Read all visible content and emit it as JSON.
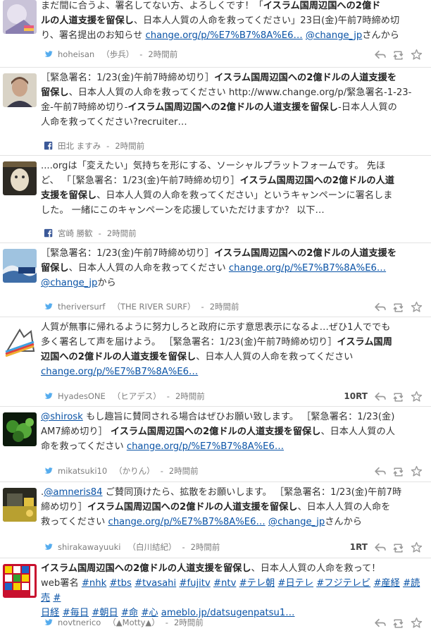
{
  "posts": [
    {
      "lines": [
        [
          {
            "t": "まだ間に合うよ、署名してない方、よろしくです！「"
          },
          {
            "t": "イスラム国周辺国への2億ド",
            "b": 1
          }
        ],
        [
          {
            "t": "ルの人道支援を留保し",
            "b": 1
          },
          {
            "t": "、日本人人質の人命を救ってください」23日(金)午前7時締め切"
          }
        ],
        [
          {
            "t": "り、署名提出のお知らせ "
          },
          {
            "t": "change.org/p/%E7%B7%8A%E6…",
            "a": 1
          },
          {
            "t": " "
          },
          {
            "t": "@change_jp",
            "a": 1
          },
          {
            "t": "さんから"
          }
        ]
      ],
      "user": "hoheisan",
      "realname": "（歩兵）",
      "time": "2時間前",
      "source": "twitter",
      "rt": ""
    },
    {
      "lines": [
        [
          {
            "t": "［緊急署名：1/23(金)午前7時締め切り］"
          },
          {
            "t": "イスラム国周辺国への2億ドルの人道支援を",
            "b": 1
          }
        ],
        [
          {
            "t": "留保し",
            "b": 1
          },
          {
            "t": "、日本人人質の人命を救ってください http://www.change.org/p/緊急署名-1-23-"
          }
        ],
        [
          {
            "t": "金-午前7時締め切り-"
          },
          {
            "t": "イスラム国周辺国への2億ドルの人道支援を留保し",
            "b": 1
          },
          {
            "t": "-日本人人質の"
          }
        ],
        [
          {
            "t": "人命を救ってください?recruiter…"
          }
        ]
      ],
      "user": "田北 ますみ",
      "realname": "",
      "time": "2時間前",
      "source": "facebook",
      "rt": ""
    },
    {
      "lines": [
        [
          {
            "t": "....orgは「変えたい」気持ちを形にする、ソーシャルプラットフォームです。 先ほ"
          }
        ],
        [
          {
            "t": "ど、 「［緊急署名：1/23(金)午前7時締め切り］"
          },
          {
            "t": "イスラム国周辺国への2億ドルの人道",
            "b": 1
          }
        ],
        [
          {
            "t": "支援を留保し",
            "b": 1
          },
          {
            "t": "、日本人人質の人命を救ってください」というキャンペーンに署名しま"
          }
        ],
        [
          {
            "t": "した。 一緒にこのキャンペーンを応援していただけますか？ 以下…"
          }
        ]
      ],
      "user": "宮崎 勝歓",
      "realname": "",
      "time": "2時間前",
      "source": "facebook",
      "rt": ""
    },
    {
      "lines": [
        [
          {
            "t": "［緊急署名：1/23(金)午前7時締め切り］"
          },
          {
            "t": "イスラム国周辺国への2億ドルの人道支援を",
            "b": 1
          }
        ],
        [
          {
            "t": "留保し",
            "b": 1
          },
          {
            "t": "、日本人人質の人命を救ってください "
          },
          {
            "t": "change.org/p/%E7%B7%8A%E6…",
            "a": 1
          }
        ],
        [
          {
            "t": "@change_jp",
            "a": 1
          },
          {
            "t": "から"
          }
        ]
      ],
      "user": "theriversurf",
      "realname": "（THE RIVER SURF）",
      "time": "2時間前",
      "source": "twitter",
      "rt": ""
    },
    {
      "lines": [
        [
          {
            "t": "人質が無事に帰れるように努力しろと政府に示す意思表示になるよ…ぜひ1人ででも"
          }
        ],
        [
          {
            "t": "多く署名して声を届けよう。 ［緊急署名：1/23(金)午前7時締め切り］"
          },
          {
            "t": "イスラム国周",
            "b": 1
          }
        ],
        [
          {
            "t": "辺国への2億ドルの人道支援を留保し",
            "b": 1
          },
          {
            "t": "、日本人人質の人命を救ってください"
          }
        ],
        [
          {
            "t": "change.org/p/%E7%B7%8A%E6…",
            "a": 1
          }
        ]
      ],
      "user": "HyadesONE",
      "realname": "（ヒアデス）",
      "time": "2時間前",
      "source": "twitter",
      "rt": "10RT"
    },
    {
      "lines": [
        [
          {
            "t": "@shirosk",
            "a": 1
          },
          {
            "t": " もし趣旨に賛同される場合はぜひお願い致します。 ［緊急署名：1/23(金)"
          }
        ],
        [
          {
            "t": "AM7締め切り］ "
          },
          {
            "t": "イスラム国周辺国への2億ドルの人道支援を留保し",
            "b": 1
          },
          {
            "t": "、日本人人質の人"
          }
        ],
        [
          {
            "t": "命を救ってください "
          },
          {
            "t": "change.org/p/%E7%B7%8A%E6…",
            "a": 1
          }
        ]
      ],
      "user": "mikatsuki10",
      "realname": "（かりん）",
      "time": "2時間前",
      "source": "twitter",
      "rt": ""
    },
    {
      "lines": [
        [
          {
            "t": "."
          },
          {
            "t": "@amneris84",
            "a": 1
          },
          {
            "t": " ご賛同頂けたら、拡散をお願いします。 ［緊急署名：1/23(金)午前7時"
          }
        ],
        [
          {
            "t": "締め切り］"
          },
          {
            "t": "イスラム国周辺国への2億ドルの人道支援を留保し",
            "b": 1
          },
          {
            "t": "、日本人人質の人命を"
          }
        ],
        [
          {
            "t": "救ってください "
          },
          {
            "t": "change.org/p/%E7%B7%8A%E6…",
            "a": 1
          },
          {
            "t": " "
          },
          {
            "t": "@change_jp",
            "a": 1
          },
          {
            "t": "さんから"
          }
        ]
      ],
      "user": "shirakawayuuki",
      "realname": "（白川結紀）",
      "time": "2時間前",
      "source": "twitter",
      "rt": "1RT"
    },
    {
      "lines": [
        [
          {
            "t": "イスラム国周辺国への2億ドルの人道支援を留保し",
            "b": 1
          },
          {
            "t": "、日本人人質の人命を救って！"
          }
        ],
        [
          {
            "t": "web署名 "
          },
          {
            "t": "#nhk",
            "a": 1
          },
          {
            "t": " "
          },
          {
            "t": "#tbs",
            "a": 1
          },
          {
            "t": " "
          },
          {
            "t": "#tvasahi",
            "a": 1
          },
          {
            "t": " "
          },
          {
            "t": "#fujitv",
            "a": 1
          },
          {
            "t": " "
          },
          {
            "t": "#ntv",
            "a": 1
          },
          {
            "t": " "
          },
          {
            "t": "#テレ朝",
            "a": 1
          },
          {
            "t": " "
          },
          {
            "t": "#日テレ",
            "a": 1
          },
          {
            "t": " "
          },
          {
            "t": "#フジテレビ",
            "a": 1
          },
          {
            "t": " "
          },
          {
            "t": "#産経",
            "a": 1
          },
          {
            "t": " "
          },
          {
            "t": "#読売",
            "a": 1
          },
          {
            "t": " "
          },
          {
            "t": "#",
            "a": 1
          }
        ],
        [
          {
            "t": "日経",
            "a": 1
          },
          {
            "t": " "
          },
          {
            "t": "#毎日",
            "a": 1
          },
          {
            "t": " "
          },
          {
            "t": "#朝日",
            "a": 1
          },
          {
            "t": " "
          },
          {
            "t": "#命",
            "a": 1
          },
          {
            "t": " "
          },
          {
            "t": "#心",
            "a": 1
          },
          {
            "t": " "
          },
          {
            "t": "ameblo.jp/datsugenpatsu1…",
            "a": 1
          }
        ]
      ],
      "user": "novtnerico",
      "realname": "（▲Motty▲）",
      "time": "2時間前",
      "source": "twitter",
      "rt": ""
    }
  ],
  "colors": {
    "link": "#0a53a6",
    "twitter": "#55acee",
    "facebook": "#3b5998",
    "icon": "#9a9a9a"
  }
}
